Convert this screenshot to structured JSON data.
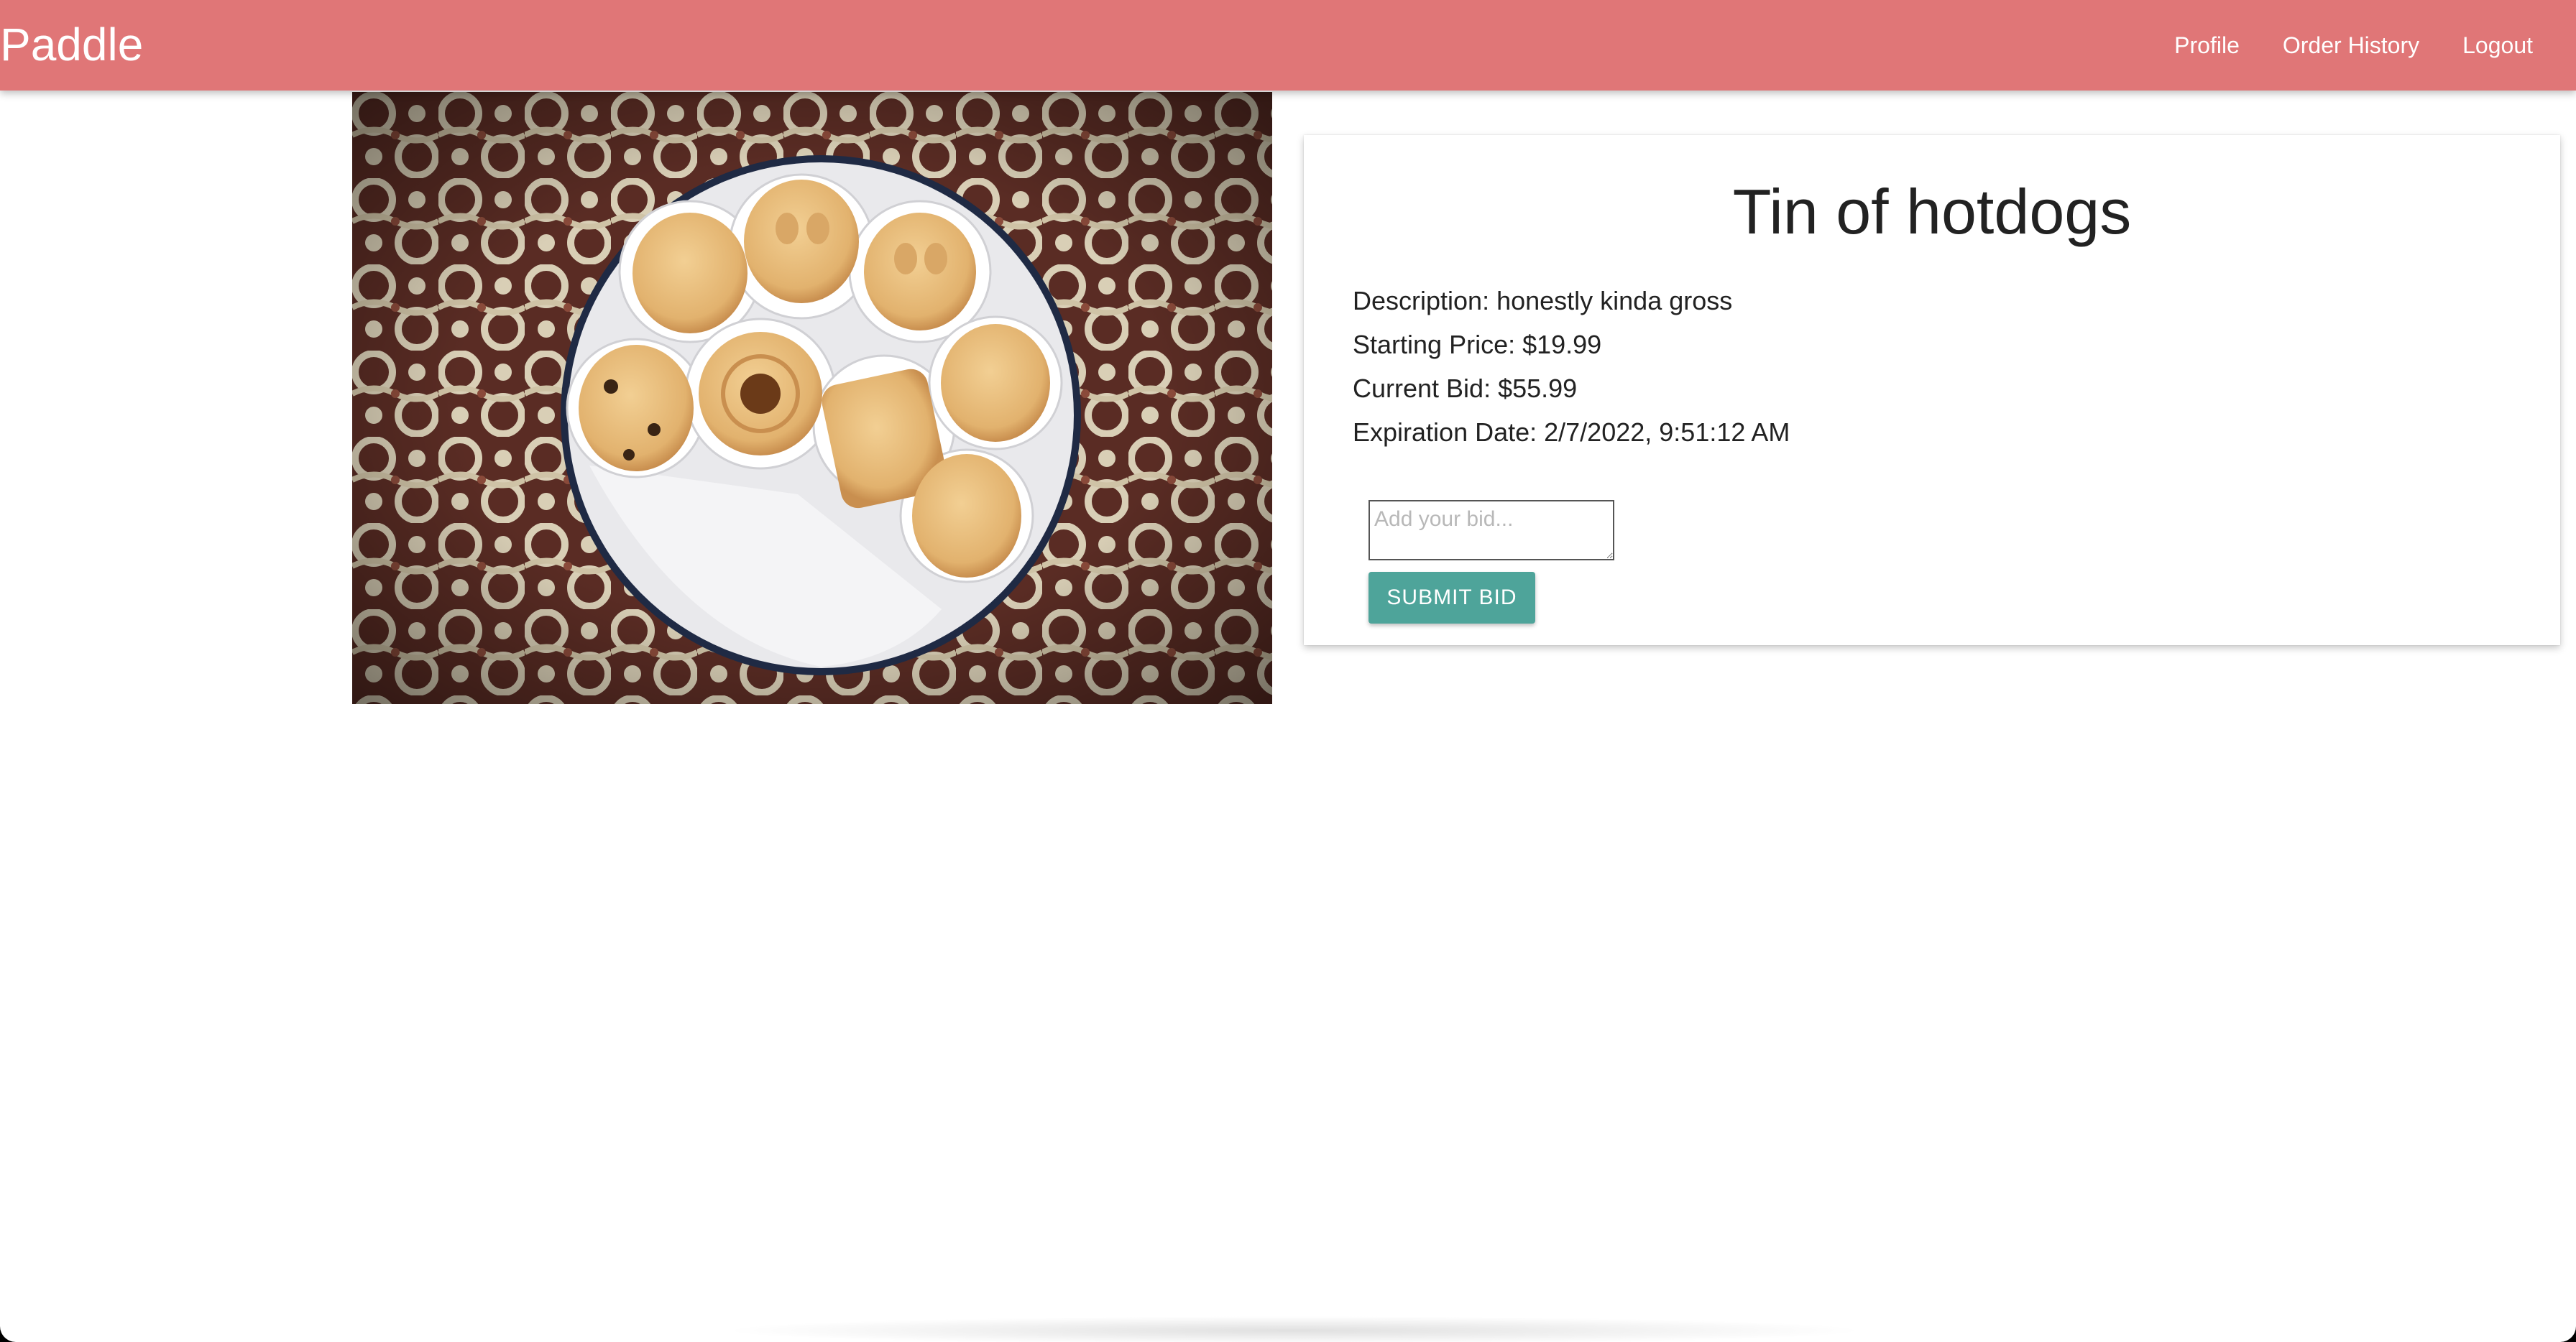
{
  "navbar": {
    "brand": "Paddle",
    "links": [
      "Profile",
      "Order History",
      "Logout"
    ],
    "color": "#e07677"
  },
  "product": {
    "image_icon": "cookie-tin-photo",
    "title": "Tin of hotdogs",
    "description": "Description: honestly kinda gross",
    "starting_price": "Starting Price: $19.99",
    "current_bid": "Current Bid: $55.99",
    "expiration": "Expiration Date: 2/7/2022, 9:51:12 AM"
  },
  "bid": {
    "placeholder": "Add your bid...",
    "value": "",
    "submit_label": "SUBMIT BID",
    "button_color": "#4ea49a"
  }
}
